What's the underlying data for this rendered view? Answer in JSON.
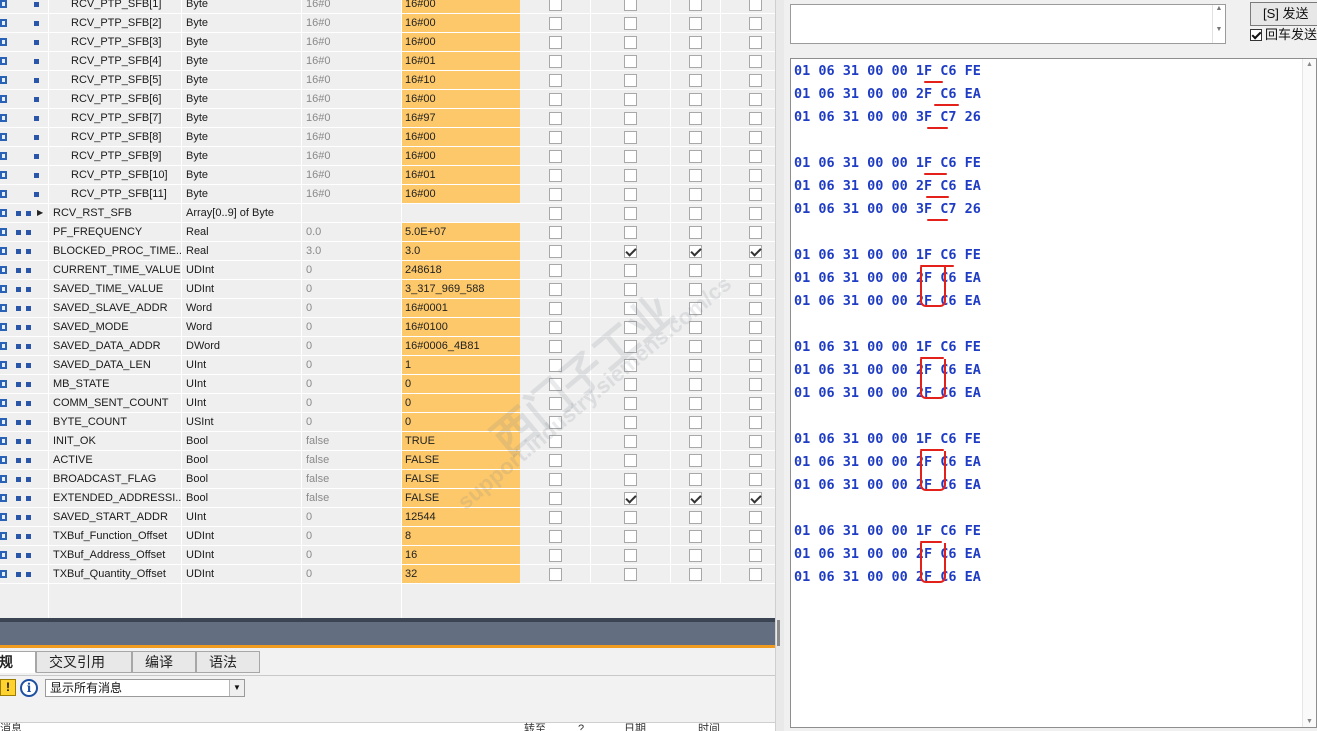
{
  "watch_table": {
    "rows": [
      {
        "name": "RCV_PTP_SFB[1]",
        "type": "Byte",
        "start": "16#0",
        "monitor": "16#00",
        "depth": 2,
        "checks": [
          false,
          false,
          false,
          false
        ]
      },
      {
        "name": "RCV_PTP_SFB[2]",
        "type": "Byte",
        "start": "16#0",
        "monitor": "16#00",
        "depth": 2,
        "checks": [
          false,
          false,
          false,
          false
        ]
      },
      {
        "name": "RCV_PTP_SFB[3]",
        "type": "Byte",
        "start": "16#0",
        "monitor": "16#00",
        "depth": 2,
        "checks": [
          false,
          false,
          false,
          false
        ]
      },
      {
        "name": "RCV_PTP_SFB[4]",
        "type": "Byte",
        "start": "16#0",
        "monitor": "16#01",
        "depth": 2,
        "checks": [
          false,
          false,
          false,
          false
        ]
      },
      {
        "name": "RCV_PTP_SFB[5]",
        "type": "Byte",
        "start": "16#0",
        "monitor": "16#10",
        "depth": 2,
        "checks": [
          false,
          false,
          false,
          false
        ]
      },
      {
        "name": "RCV_PTP_SFB[6]",
        "type": "Byte",
        "start": "16#0",
        "monitor": "16#00",
        "depth": 2,
        "checks": [
          false,
          false,
          false,
          false
        ]
      },
      {
        "name": "RCV_PTP_SFB[7]",
        "type": "Byte",
        "start": "16#0",
        "monitor": "16#97",
        "depth": 2,
        "checks": [
          false,
          false,
          false,
          false
        ]
      },
      {
        "name": "RCV_PTP_SFB[8]",
        "type": "Byte",
        "start": "16#0",
        "monitor": "16#00",
        "depth": 2,
        "checks": [
          false,
          false,
          false,
          false
        ]
      },
      {
        "name": "RCV_PTP_SFB[9]",
        "type": "Byte",
        "start": "16#0",
        "monitor": "16#00",
        "depth": 2,
        "checks": [
          false,
          false,
          false,
          false
        ]
      },
      {
        "name": "RCV_PTP_SFB[10]",
        "type": "Byte",
        "start": "16#0",
        "monitor": "16#01",
        "depth": 2,
        "checks": [
          false,
          false,
          false,
          false
        ]
      },
      {
        "name": "RCV_PTP_SFB[11]",
        "type": "Byte",
        "start": "16#0",
        "monitor": "16#00",
        "depth": 2,
        "checks": [
          false,
          false,
          false,
          false
        ]
      },
      {
        "name": "RCV_RST_SFB",
        "type": "Array[0..9] of Byte",
        "start": "",
        "monitor": "",
        "depth": 1,
        "expandable": true,
        "checks": [
          false,
          false,
          false,
          false
        ]
      },
      {
        "name": "PF_FREQUENCY",
        "type": "Real",
        "start": "0.0",
        "monitor": "5.0E+07",
        "depth": 1,
        "checks": [
          false,
          false,
          false,
          false
        ]
      },
      {
        "name": "BLOCKED_PROC_TIME...",
        "type": "Real",
        "start": "3.0",
        "monitor": "3.0",
        "depth": 1,
        "checks": [
          false,
          true,
          true,
          true
        ]
      },
      {
        "name": "CURRENT_TIME_VALUE",
        "type": "UDInt",
        "start": "0",
        "monitor": "248618",
        "depth": 1,
        "checks": [
          false,
          false,
          false,
          false
        ]
      },
      {
        "name": "SAVED_TIME_VALUE",
        "type": "UDInt",
        "start": "0",
        "monitor": "3_317_969_588",
        "depth": 1,
        "checks": [
          false,
          false,
          false,
          false
        ]
      },
      {
        "name": "SAVED_SLAVE_ADDR",
        "type": "Word",
        "start": "0",
        "monitor": "16#0001",
        "depth": 1,
        "checks": [
          false,
          false,
          false,
          false
        ]
      },
      {
        "name": "SAVED_MODE",
        "type": "Word",
        "start": "0",
        "monitor": "16#0100",
        "depth": 1,
        "checks": [
          false,
          false,
          false,
          false
        ]
      },
      {
        "name": "SAVED_DATA_ADDR",
        "type": "DWord",
        "start": "0",
        "monitor": "16#0006_4B81",
        "depth": 1,
        "checks": [
          false,
          false,
          false,
          false
        ]
      },
      {
        "name": "SAVED_DATA_LEN",
        "type": "UInt",
        "start": "0",
        "monitor": "1",
        "depth": 1,
        "checks": [
          false,
          false,
          false,
          false
        ]
      },
      {
        "name": "MB_STATE",
        "type": "UInt",
        "start": "0",
        "monitor": "0",
        "depth": 1,
        "checks": [
          false,
          false,
          false,
          false
        ]
      },
      {
        "name": "COMM_SENT_COUNT",
        "type": "UInt",
        "start": "0",
        "monitor": "0",
        "depth": 1,
        "checks": [
          false,
          false,
          false,
          false
        ]
      },
      {
        "name": "BYTE_COUNT",
        "type": "USInt",
        "start": "0",
        "monitor": "0",
        "depth": 1,
        "checks": [
          false,
          false,
          false,
          false
        ]
      },
      {
        "name": "INIT_OK",
        "type": "Bool",
        "start": "false",
        "monitor": "TRUE",
        "depth": 1,
        "checks": [
          false,
          false,
          false,
          false
        ]
      },
      {
        "name": "ACTIVE",
        "type": "Bool",
        "start": "false",
        "monitor": "FALSE",
        "depth": 1,
        "checks": [
          false,
          false,
          false,
          false
        ]
      },
      {
        "name": "BROADCAST_FLAG",
        "type": "Bool",
        "start": "false",
        "monitor": "FALSE",
        "depth": 1,
        "checks": [
          false,
          false,
          false,
          false
        ]
      },
      {
        "name": "EXTENDED_ADDRESSI...",
        "type": "Bool",
        "start": "false",
        "monitor": "FALSE",
        "depth": 1,
        "checks": [
          false,
          true,
          true,
          true
        ]
      },
      {
        "name": "SAVED_START_ADDR",
        "type": "UInt",
        "start": "0",
        "monitor": "12544",
        "depth": 1,
        "checks": [
          false,
          false,
          false,
          false
        ]
      },
      {
        "name": "TXBuf_Function_Offset",
        "type": "UDInt",
        "start": "0",
        "monitor": "8",
        "depth": 1,
        "checks": [
          false,
          false,
          false,
          false
        ]
      },
      {
        "name": "TXBuf_Address_Offset",
        "type": "UDInt",
        "start": "0",
        "monitor": "16",
        "depth": 1,
        "checks": [
          false,
          false,
          false,
          false
        ]
      },
      {
        "name": "TXBuf_Quantity_Offset",
        "type": "UDInt",
        "start": "0",
        "monitor": "32",
        "depth": 1,
        "checks": [
          false,
          false,
          false,
          false
        ]
      }
    ]
  },
  "inspector": {
    "tabs": [
      {
        "label": "规",
        "active": true
      },
      {
        "label": "交叉引用",
        "active": false
      },
      {
        "label": "编译",
        "active": false
      },
      {
        "label": "语法",
        "active": false
      }
    ],
    "warn_glyph": "!",
    "info_glyph": "i",
    "filter_value": "显示所有消息",
    "columns": [
      "消息",
      "转至",
      "?",
      "日期",
      "时间"
    ]
  },
  "terminal": {
    "send_label": "[S] 发送",
    "repeat_label": "回车发送",
    "repeat_checked": true,
    "lines": [
      "01 06 31 00 00 1F C6 FE",
      "01 06 31 00 00 2F C6 EA",
      "01 06 31 00 00 3F C7 26",
      "",
      "01 06 31 00 00 1F C6 FE",
      "01 06 31 00 00 2F C6 EA",
      "01 06 31 00 00 3F C7 26",
      "",
      "01 06 31 00 00 1F C6 FE",
      "01 06 31 00 00 2F C6 EA",
      "01 06 31 00 00 2F C6 EA",
      "",
      "01 06 31 00 00 1F C6 FE",
      "01 06 31 00 00 2F C6 EA",
      "01 06 31 00 00 2F C6 EA",
      "",
      "01 06 31 00 00 1F C6 FE",
      "01 06 31 00 00 2F C6 EA",
      "01 06 31 00 00 2F C6 EA",
      "",
      "01 06 31 00 00 1F C6 FE",
      "01 06 31 00 00 2F C6 EA",
      "01 06 31 00 00 2F C6 EA"
    ]
  },
  "watermark": {
    "text_cn": "西门子工业",
    "text_en": "support.industry.siemens.com/cs"
  },
  "colors": {
    "monitor_bg": "#fdc86a",
    "hex_text": "#1f3cc4",
    "annotation_red": "#e4201a",
    "accent_orange": "#f29c1f"
  }
}
